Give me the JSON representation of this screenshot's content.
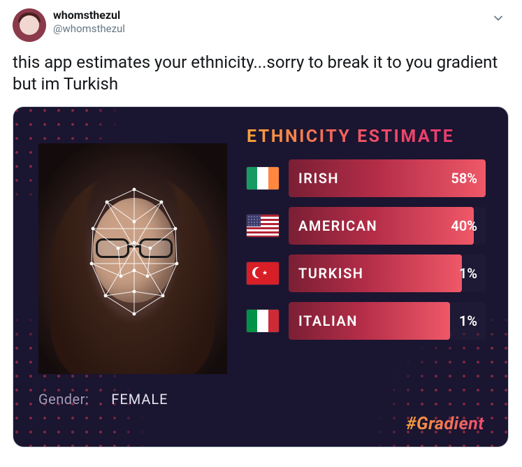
{
  "tweet": {
    "display_name": "whomsthezul",
    "handle": "@whomsthezul",
    "text": "this app estimates your ethnicity...sorry to break it to you gradient but im Turkish"
  },
  "card": {
    "title": "ETHNICITY ESTIMATE",
    "gender_label": "Gender:",
    "gender_value": "FEMALE",
    "hashtag": "#Gradient",
    "results": [
      {
        "label": "IRISH",
        "pct": "58%",
        "fill": 100,
        "flag": "ireland"
      },
      {
        "label": "AMERICAN",
        "pct": "40%",
        "fill": 94,
        "flag": "usa"
      },
      {
        "label": "TURKISH",
        "pct": "1%",
        "fill": 88,
        "flag": "turkey"
      },
      {
        "label": "ITALIAN",
        "pct": "1%",
        "fill": 82,
        "flag": "italy"
      }
    ]
  },
  "chart_data": {
    "type": "bar",
    "title": "ETHNICITY ESTIMATE",
    "categories": [
      "IRISH",
      "AMERICAN",
      "TURKISH",
      "ITALIAN"
    ],
    "values": [
      58,
      40,
      1,
      1
    ],
    "xlabel": "",
    "ylabel": "Percent",
    "ylim": [
      0,
      100
    ]
  }
}
